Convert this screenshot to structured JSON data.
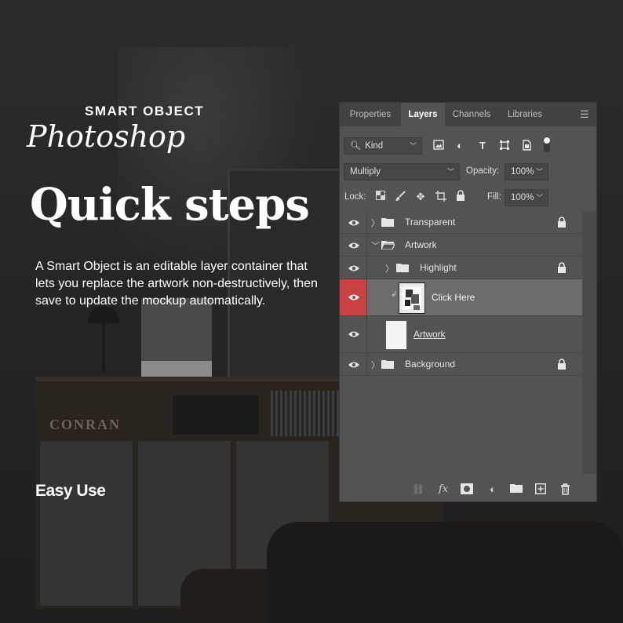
{
  "hero": {
    "kicker": "SMART OBJECT",
    "app": "Photoshop",
    "title": "Quick steps",
    "description": "A Smart Object is an editable layer container that lets you replace the artwork non-destructively, then save to update the mockup automatically.",
    "cta": "Easy Use"
  },
  "background": {
    "brand_text": "CONRAN"
  },
  "panel": {
    "tabs": [
      {
        "label": "Properties",
        "active": false
      },
      {
        "label": "Layers",
        "active": true
      },
      {
        "label": "Channels",
        "active": false
      },
      {
        "label": "Libraries",
        "active": false
      }
    ],
    "filter": {
      "kind_label": "Kind"
    },
    "blend": {
      "mode": "Multiply",
      "opacity_label": "Opacity:",
      "opacity_value": "100%"
    },
    "lock": {
      "lock_label": "Lock:",
      "fill_label": "Fill:",
      "fill_value": "100%"
    },
    "layers": [
      {
        "name": "Transparent",
        "type": "group",
        "expanded": false,
        "locked": true,
        "indent": 0
      },
      {
        "name": "Artwork",
        "type": "group",
        "expanded": true,
        "locked": false,
        "indent": 0
      },
      {
        "name": "Highlight",
        "type": "group",
        "expanded": false,
        "locked": true,
        "indent": 1
      },
      {
        "name": "Click Here",
        "type": "smart-object",
        "selected": true,
        "clipped": true,
        "indent": 1
      },
      {
        "name": "Artwork",
        "type": "layer",
        "underline": true,
        "indent": 1
      },
      {
        "name": "Background",
        "type": "group",
        "expanded": false,
        "locked": true,
        "indent": 0
      }
    ]
  },
  "colors": {
    "selected_eye": "#c94141",
    "panel_bg": "#535353",
    "tab_bg": "#424242"
  }
}
